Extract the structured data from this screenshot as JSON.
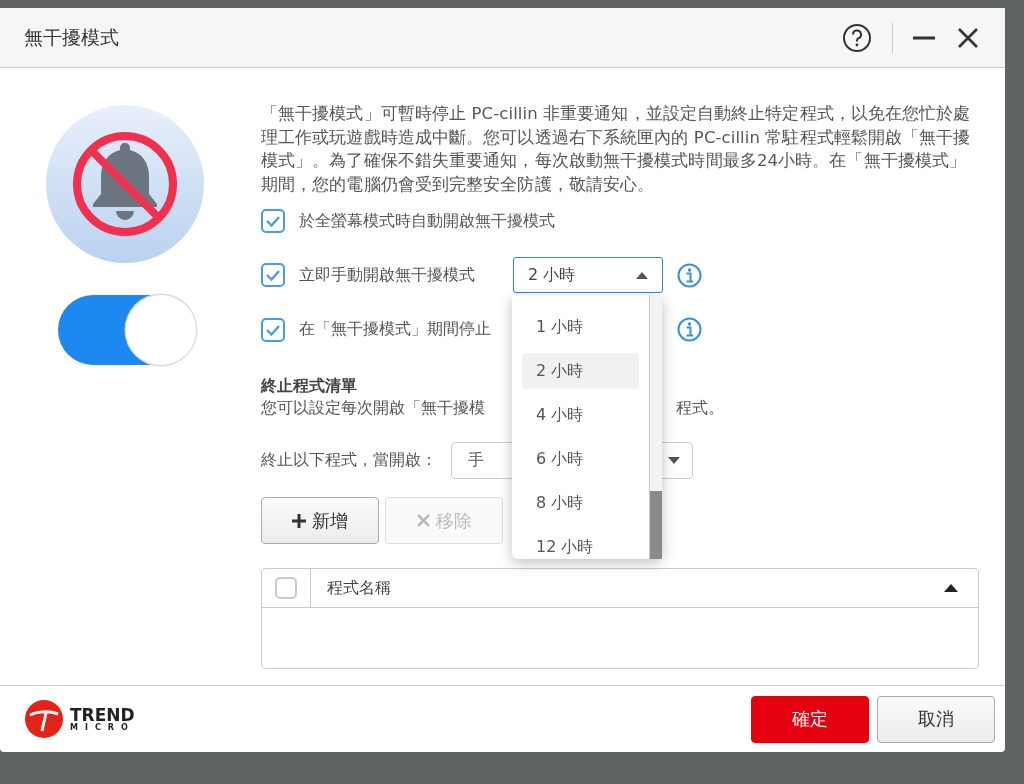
{
  "window": {
    "title": "無干擾模式"
  },
  "toggle": {
    "on": true
  },
  "description": "「無干擾模式」可暫時停止 PC-cillin 非重要通知，並設定自動終止特定程式，以免在您忙於處理工作或玩遊戲時造成中斷。您可以透過右下系統匣內的 PC-cillin 常駐程式輕鬆開啟「無干擾模式」。為了確保不錯失重要通知，每次啟動無干擾模式時間最多24小時。在「無干擾模式」期間，您的電腦仍會受到完整安全防護，敬請安心。",
  "options": [
    {
      "kind": "plain",
      "label": "於全螢幕模式時自動開啟無干擾模式",
      "checked": true
    },
    {
      "kind": "duration",
      "label": "立即手動開啟無干擾模式",
      "checked": true,
      "value": "2 小時",
      "info": true
    },
    {
      "kind": "info",
      "label": "在「無干擾模式」期間停止",
      "checked": true,
      "info": true
    }
  ],
  "duration_menu": [
    {
      "label": "1 小時",
      "selected": false
    },
    {
      "label": "2 小時",
      "selected": true
    },
    {
      "label": "4 小時",
      "selected": false
    },
    {
      "label": "6 小時",
      "selected": false
    },
    {
      "label": "8 小時",
      "selected": false
    },
    {
      "label": "12 小時",
      "selected": false
    }
  ],
  "kill_list": {
    "heading": "終止程式清單",
    "subtitle_parts": [
      "您可以設定每次開啟「無干擾模",
      "程式。"
    ],
    "trigger_label": "終止以下程式，當開啟：",
    "trigger_value": "手"
  },
  "list_buttons": [
    {
      "kind": "add",
      "label": "新增",
      "disabled": false
    },
    {
      "kind": "remove",
      "label": "移除",
      "disabled": true
    }
  ],
  "table": {
    "header_checked": false,
    "columns": [
      "程式名稱"
    ]
  },
  "footer": {
    "logo_top": "TREND",
    "logo_bottom": "MICRO",
    "buttons": [
      {
        "kind": "primary",
        "label": "確定"
      },
      {
        "kind": "secondary",
        "label": "取消"
      }
    ]
  }
}
